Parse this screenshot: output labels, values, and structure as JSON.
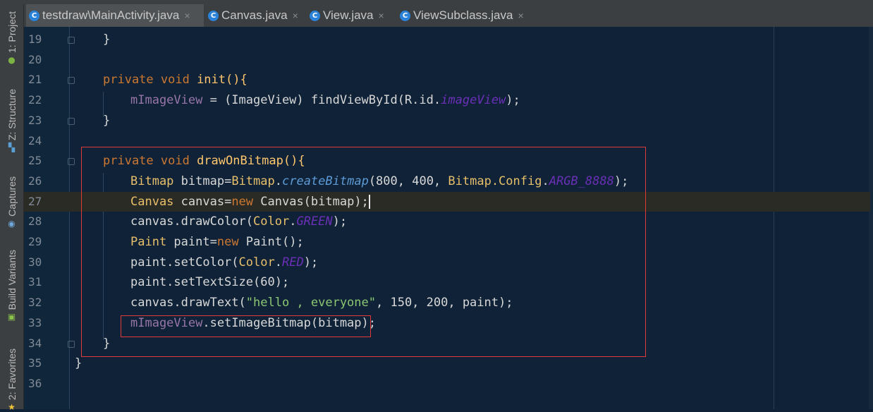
{
  "tabs": [
    {
      "label": "testdraw\\MainActivity.java",
      "active": true
    },
    {
      "label": "Canvas.java",
      "active": false
    },
    {
      "label": "View.java",
      "active": false
    },
    {
      "label": "ViewSubclass.java",
      "active": false
    }
  ],
  "tab_close_glyph": "×",
  "tab_icon_letter": "C",
  "sidebar": [
    {
      "label": "1: Project"
    },
    {
      "label": "Z: Structure"
    },
    {
      "label": "Captures"
    },
    {
      "label": "Build Variants"
    },
    {
      "label": "2: Favorites"
    }
  ],
  "line_numbers": [
    "19",
    "20",
    "21",
    "22",
    "23",
    "24",
    "25",
    "26",
    "27",
    "28",
    "29",
    "30",
    "31",
    "32",
    "33",
    "34",
    "35",
    "36"
  ],
  "code": {
    "l19": "}",
    "l21_kw": "private void ",
    "l21_rest": "init(){",
    "l22_field": "mImageView",
    "l22_mid": " = (ImageView) findViewById(R.id.",
    "l22_const": "imageView",
    "l22_end": ");",
    "l23": "}",
    "l25_kw": "private void ",
    "l25_rest": "drawOnBitmap(){",
    "l26_type": "Bitmap",
    "l26_a": " bitmap=",
    "l26_type2": "Bitmap",
    "l26_dot": ".",
    "l26_static": "createBitmap",
    "l26_b": "(800, 400, ",
    "l26_type3": "Bitmap.Config",
    "l26_dot2": ".",
    "l26_const": "ARGB_8888",
    "l26_end": ");",
    "l27_type": "Canvas",
    "l27_a": " canvas=",
    "l27_kw": "new ",
    "l27_b": "Canvas(bitmap);",
    "l28_a": "canvas.drawColor(",
    "l28_type": "Color",
    "l28_dot": ".",
    "l28_const": "GREEN",
    "l28_end": ");",
    "l29_type": "Paint",
    "l29_a": " paint=",
    "l29_kw": "new ",
    "l29_b": "Paint();",
    "l30_a": "paint.setColor(",
    "l30_type": "Color",
    "l30_dot": ".",
    "l30_const": "RED",
    "l30_end": ");",
    "l31": "paint.setTextSize(60);",
    "l32_a": "canvas.drawText(",
    "l32_str": "\"hello , everyone\"",
    "l32_end": ", 150, 200, paint);",
    "l33_field": "mImageView",
    "l33_rest": ".setImageBitmap(bitmap);",
    "l34": "}",
    "l35": "}"
  },
  "colors": {
    "editor_bg": "#0f2237",
    "keyword": "#cc7832",
    "field": "#9876aa",
    "constant": "#6b2fb8",
    "type": "#e8bf6a",
    "string": "#8cc672",
    "highlight_box": "#e03a3a"
  },
  "icons": [
    "java-class-icon",
    "android-icon",
    "structure-icon",
    "captures-icon",
    "build-variants-icon",
    "favorites-star-icon"
  ]
}
